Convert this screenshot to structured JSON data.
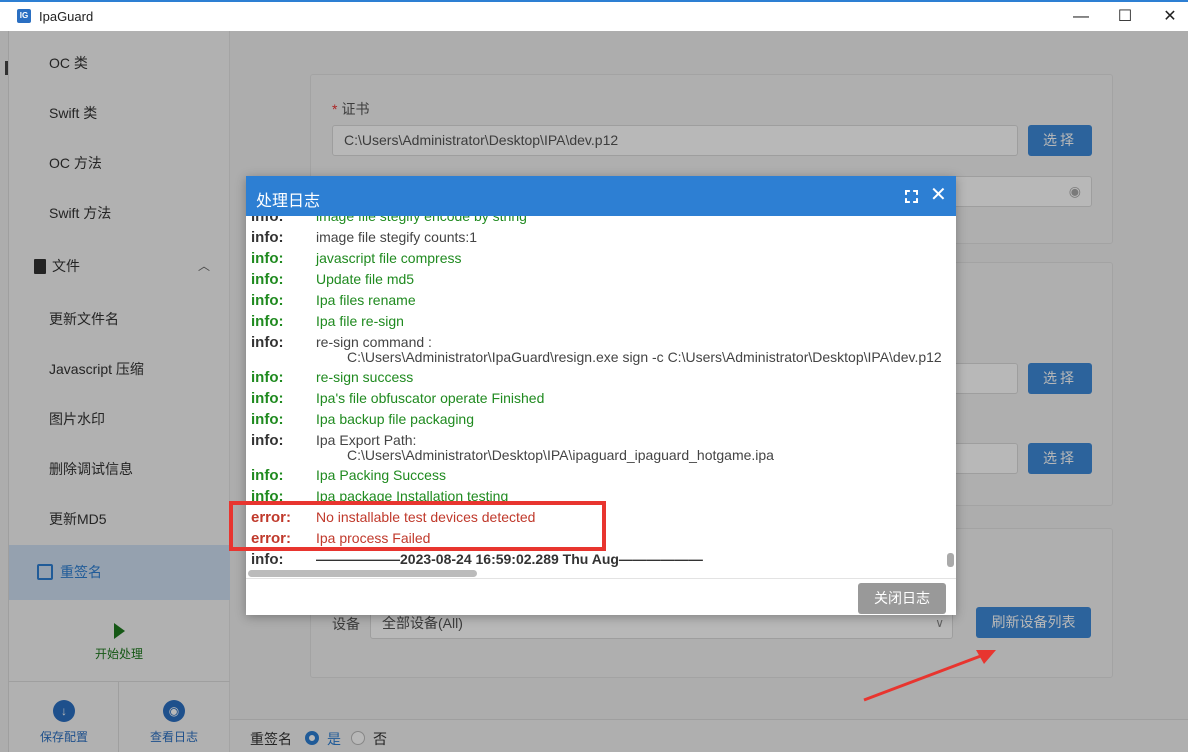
{
  "window": {
    "app_icon_text": "IG",
    "title": "IpaGuard",
    "minimize": "—",
    "maximize": "☐",
    "close": "✕"
  },
  "sidebar": {
    "items": [
      "OC 类",
      "Swift 类",
      "OC 方法",
      "Swift 方法"
    ],
    "group_label": "文件",
    "group_caret": "︿",
    "sub_items": [
      "更新文件名",
      "Javascript 压缩",
      "图片水印",
      "删除调试信息",
      "更新MD5"
    ],
    "active_item": "重签名",
    "start_label": "开始处理",
    "save_config_label": "保存配置",
    "save_config_icon": "↓",
    "view_log_label": "查看日志",
    "view_log_icon": "◉"
  },
  "main": {
    "cert_label": "证书",
    "cert_required_mark": "*",
    "cert_path": "C:\\Users\\Administrator\\Desktop\\IPA\\dev.p12",
    "select_label": "选择",
    "eye_icon": "◉",
    "device_label": "设备",
    "device_value": "全部设备(All)",
    "device_chevron": "∨",
    "refresh_devices_label": "刷新设备列表",
    "resign_label": "重签名",
    "yes_label": "是",
    "no_label": "否"
  },
  "modal": {
    "title": "处理日志",
    "close_icon": "✕",
    "close_button": "关闭日志",
    "lines": [
      {
        "level": "info:",
        "message": "image file stegify encode by string",
        "color": "#1f8a1f"
      },
      {
        "level": "info:",
        "message": "image file stegify counts:1",
        "color": "#444444"
      },
      {
        "level": "info:",
        "message": "javascript file compress",
        "color": "#1f8a1f"
      },
      {
        "level": "info:",
        "message": "Update file md5",
        "color": "#1f8a1f"
      },
      {
        "level": "info:",
        "message": "Ipa files rename",
        "color": "#1f8a1f"
      },
      {
        "level": "info:",
        "message": "Ipa file re-sign",
        "color": "#1f8a1f"
      },
      {
        "level": "info:",
        "message": "re-sign command :",
        "color": "#444444"
      },
      {
        "level": "",
        "message": "C:\\Users\\Administrator\\IpaGuard\\resign.exe sign -c C:\\Users\\Administrator\\Desktop\\IPA\\dev.p12",
        "color": "#444444"
      },
      {
        "level": "info:",
        "message": "re-sign success",
        "color": "#1f8a1f"
      },
      {
        "level": "info:",
        "message": "Ipa's file obfuscator operate Finished",
        "color": "#1f8a1f"
      },
      {
        "level": "info:",
        "message": "Ipa backup file packaging",
        "color": "#1f8a1f"
      },
      {
        "level": "info:",
        "message": "Ipa Export Path:",
        "color": "#444444"
      },
      {
        "level": "",
        "message": "C:\\Users\\Administrator\\Desktop\\IPA\\ipaguard_ipaguard_hotgame.ipa",
        "color": "#444444"
      },
      {
        "level": "info:",
        "message": "Ipa Packing Success",
        "color": "#1f8a1f"
      },
      {
        "level": "info:",
        "message": "Ipa package Installation testing",
        "color": "#1f8a1f"
      },
      {
        "level": "error:",
        "message": "No installable test devices detected",
        "color": "#c0392b"
      },
      {
        "level": "error:",
        "message": "Ipa process Failed",
        "color": "#c0392b"
      },
      {
        "level": "info:",
        "message": "——————2023-08-24 16:59:02.289 Thu Aug——————",
        "color": "#333333"
      }
    ]
  },
  "colors": {
    "accent": "#2d7fd3",
    "success": "#1f8a1f",
    "error": "#c0392b",
    "highlight": "#e8352f"
  }
}
